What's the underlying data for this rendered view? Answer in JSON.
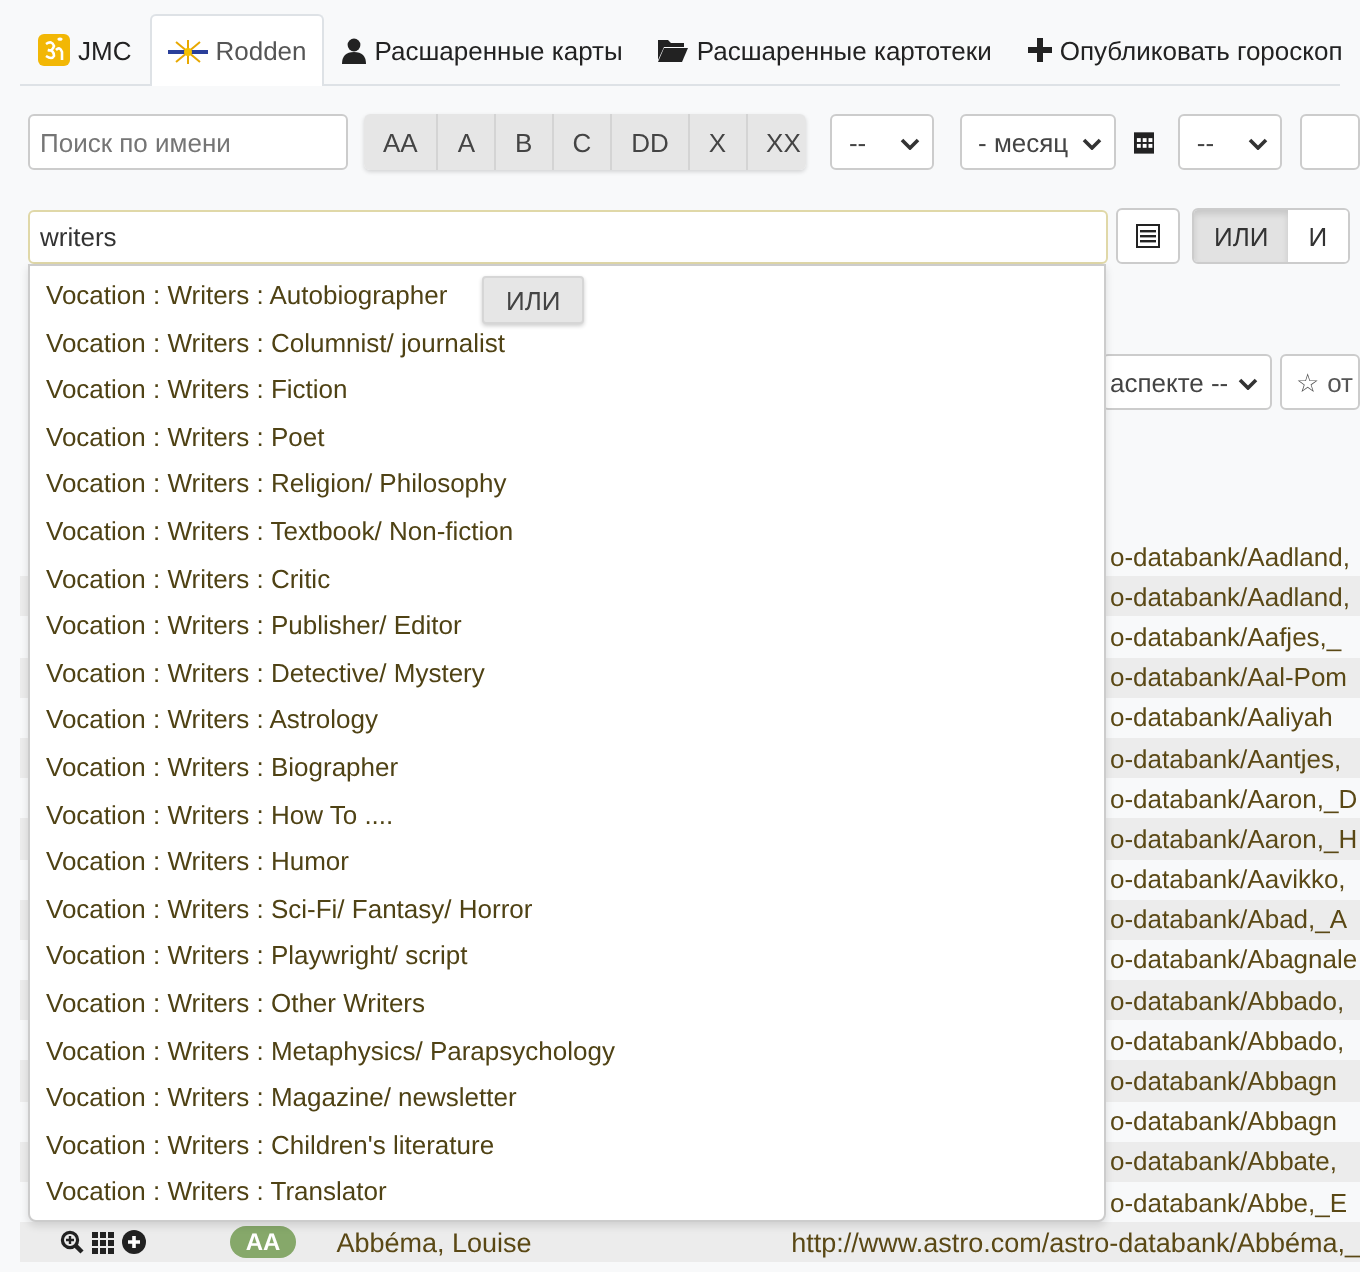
{
  "tabs": [
    {
      "label": "JMC",
      "selected": false
    },
    {
      "label": "Rodden",
      "selected": true
    },
    {
      "label": "Расшаренные карты",
      "selected": false
    },
    {
      "label": "Расшаренные картотеки",
      "selected": false
    },
    {
      "label": "Опубликовать гороскоп",
      "selected": false
    }
  ],
  "filters": {
    "name_search": {
      "placeholder": "Поиск по имени"
    },
    "grade_buttons": [
      "AA",
      "A",
      "B",
      "C",
      "DD",
      "X",
      "XX"
    ],
    "day_select": "--",
    "month_select": "- месяц",
    "year_select": "--"
  },
  "tag_search": {
    "value": "writers",
    "logic_toggle": [
      {
        "label": "ИЛИ",
        "selected": true
      },
      {
        "label": "И",
        "selected": false
      }
    ]
  },
  "suggestions": [
    "Vocation : Writers : Autobiographer",
    "Vocation : Writers : Columnist/ journalist",
    "Vocation : Writers : Fiction",
    "Vocation : Writers : Poet",
    "Vocation : Writers : Religion/ Philosophy",
    "Vocation : Writers : Textbook/ Non-fiction",
    "Vocation : Writers : Critic",
    "Vocation : Writers : Publisher/ Editor",
    "Vocation : Writers : Detective/ Mystery",
    "Vocation : Writers : Astrology",
    "Vocation : Writers : Biographer",
    "Vocation : Writers : How To ....",
    "Vocation : Writers : Humor",
    "Vocation : Writers : Sci-Fi/ Fantasy/ Horror",
    "Vocation : Writers : Playwright/ script",
    "Vocation : Writers : Other Writers",
    "Vocation : Writers : Metaphysics/ Parapsychology",
    "Vocation : Writers : Magazine/ newsletter",
    "Vocation : Writers : Children's literature",
    "Vocation : Writers : Translator"
  ],
  "floating_button": "ИЛИ",
  "aspect_select": "аспекте --",
  "star_button": "☆ от",
  "table": {
    "rows": [
      {
        "kind": "partial",
        "url": "o-databank/Aadland,"
      },
      {
        "kind": "partial",
        "url": "o-databank/Aadland,"
      },
      {
        "kind": "partial",
        "url": "o-databank/Aafjes,_"
      },
      {
        "kind": "partial",
        "url": "o-databank/Aal-Pom"
      },
      {
        "kind": "partial",
        "url": "o-databank/Aaliyah"
      },
      {
        "kind": "partial",
        "url": "o-databank/Aantjes,"
      },
      {
        "kind": "partial",
        "url": "o-databank/Aaron,_D"
      },
      {
        "kind": "partial",
        "url": "o-databank/Aaron,_H"
      },
      {
        "kind": "partial",
        "url": "o-databank/Aavikko,"
      },
      {
        "kind": "partial",
        "url": "o-databank/Abad,_A"
      },
      {
        "kind": "partial",
        "url": "o-databank/Abagnale"
      },
      {
        "kind": "partial",
        "url": "o-databank/Abbado,"
      },
      {
        "kind": "partial",
        "url": "o-databank/Abbado,"
      },
      {
        "kind": "partial",
        "url": "o-databank/Abbagn"
      },
      {
        "kind": "partial",
        "url": "o-databank/Abbagn"
      },
      {
        "kind": "partial",
        "url": "o-databank/Abbate,"
      },
      {
        "kind": "partial",
        "url": "o-databank/Abbe,_E"
      },
      {
        "kind": "full",
        "grade": "AA",
        "name": "Abbéma, Louise",
        "url": "http://www.astro.com/astro-databank/Abbéma,_"
      }
    ]
  }
}
